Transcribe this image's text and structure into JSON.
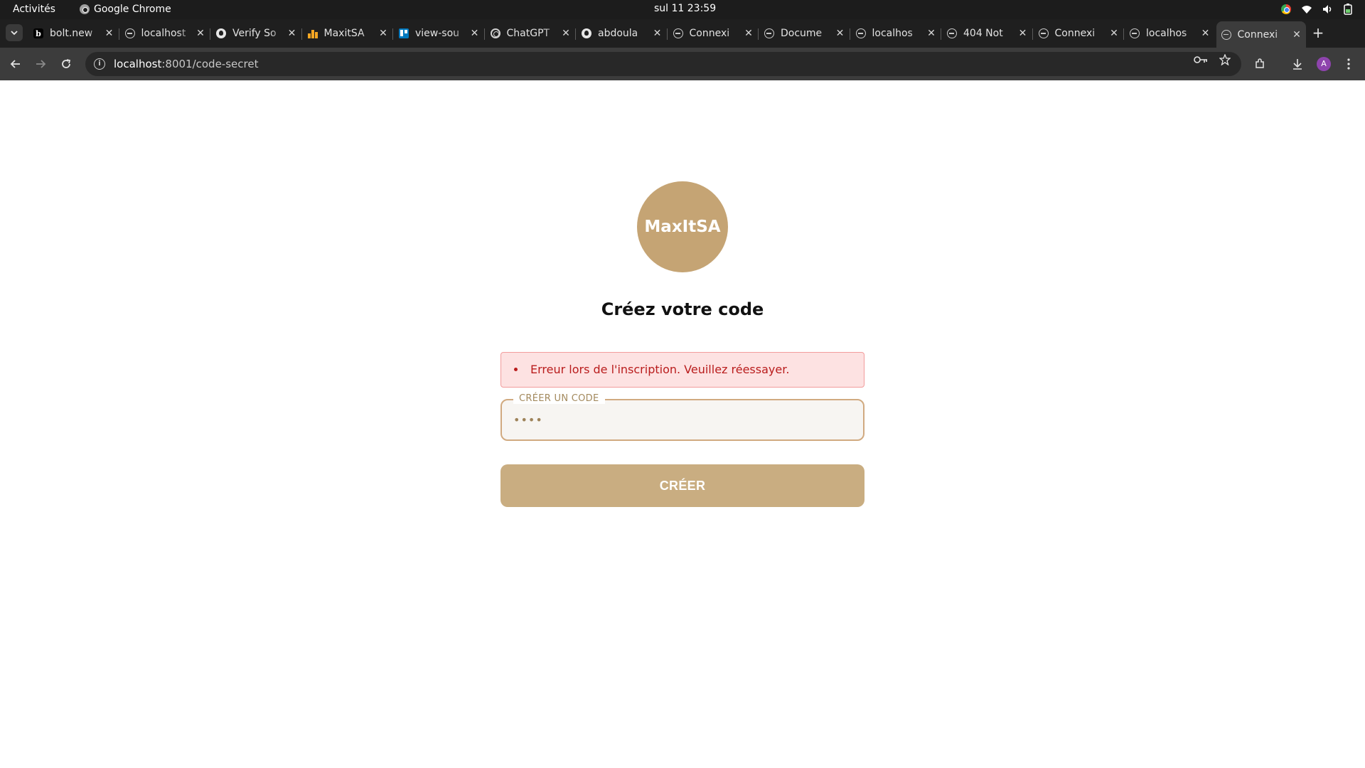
{
  "system_bar": {
    "activities": "Activités",
    "app_name": "Google Chrome",
    "clock": "sul 11  23:59"
  },
  "tabs": [
    {
      "title": "bolt.new",
      "icon": "bolt-icon"
    },
    {
      "title": "localhost",
      "icon": "globe-icon"
    },
    {
      "title": "Verify So",
      "icon": "github-icon"
    },
    {
      "title": "MaxitSA",
      "icon": "maxit-icon"
    },
    {
      "title": "view-sou",
      "icon": "trello-icon"
    },
    {
      "title": "ChatGPT",
      "icon": "chatgpt-icon"
    },
    {
      "title": "abdoula",
      "icon": "github-icon"
    },
    {
      "title": "Connexi",
      "icon": "globe-icon"
    },
    {
      "title": "Docume",
      "icon": "globe-icon"
    },
    {
      "title": "localhos",
      "icon": "globe-icon"
    },
    {
      "title": "404 Not",
      "icon": "globe-icon"
    },
    {
      "title": "Connexi",
      "icon": "globe-icon"
    },
    {
      "title": "localhos",
      "icon": "globe-icon"
    },
    {
      "title": "Connexi",
      "icon": "globe-icon",
      "active": true
    }
  ],
  "address_bar": {
    "host": "localhost",
    "rest": ":8001/code-secret"
  },
  "profile_initial": "A",
  "page": {
    "logo_text": "MaxItSA",
    "heading": "Créez votre code",
    "errors": [
      "Erreur lors de l'inscription. Veuillez réessayer."
    ],
    "code_field": {
      "label": "CRÉER UN CODE",
      "masked_value": "••••"
    },
    "submit_label": "CRÉER"
  },
  "colors": {
    "brand": "#c5a474",
    "button": "#c9ad81",
    "error_text": "#b91c1c",
    "error_bg": "#fde2e2"
  }
}
